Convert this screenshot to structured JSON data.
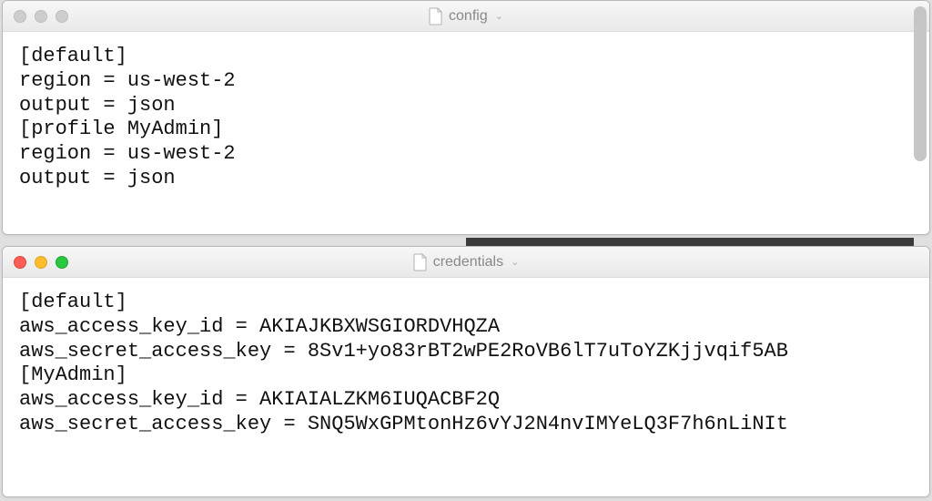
{
  "windows": [
    {
      "title": "config",
      "active": false,
      "lines": [
        "[default]",
        "region = us-west-2",
        "output = json",
        "[profile MyAdmin]",
        "region = us-west-2",
        "output = json"
      ]
    },
    {
      "title": "credentials",
      "active": true,
      "lines": [
        "[default]",
        "aws_access_key_id = AKIAJKBXWSGIORDVHQZA",
        "aws_secret_access_key = 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",
        "[MyAdmin]",
        "aws_access_key_id = AKIAIALZKM6IUQACBF2Q",
        "aws_secret_access_key = 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"
      ]
    }
  ],
  "chevron": "⌄"
}
